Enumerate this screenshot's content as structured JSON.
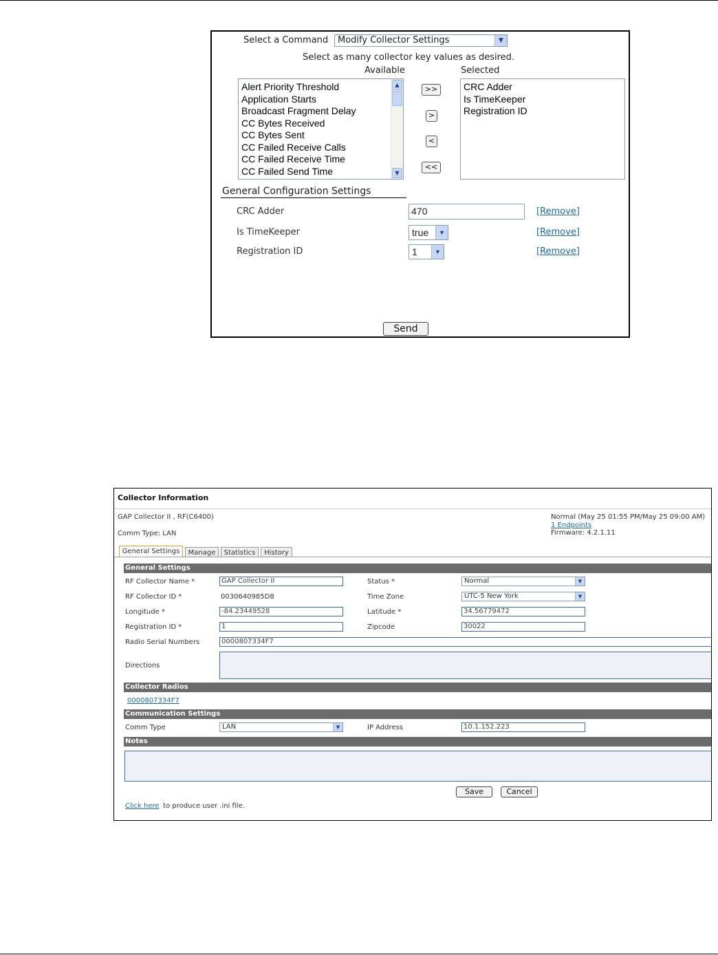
{
  "command_panel": {
    "select_command_label": "Select a Command",
    "command_value": "Modify Collector Settings",
    "instruction": "Select as many collector key values as desired.",
    "available_header": "Available",
    "selected_header": "Selected",
    "available_items": [
      "Alert Priority Threshold",
      "Application Starts",
      "Broadcast Fragment Delay",
      "CC Bytes Received",
      "CC Bytes Sent",
      "CC Failed Receive Calls",
      "CC Failed Receive Time",
      "CC Failed Send Time"
    ],
    "selected_items": [
      "CRC Adder",
      "Is TimeKeeper",
      "Registration ID"
    ],
    "move_buttons": {
      "add_all": ">>",
      "add": ">",
      "remove": "<",
      "remove_all": "<<"
    },
    "section_title": "General Configuration Settings",
    "settings": [
      {
        "label": "CRC Adder",
        "value": "470",
        "remove": "[Remove]"
      },
      {
        "label": "Is TimeKeeper",
        "value": "true",
        "remove": "[Remove]"
      },
      {
        "label": "Registration ID",
        "value": "1",
        "remove": "[Remove]"
      }
    ],
    "send_label": "Send"
  },
  "collector_info": {
    "title": "Collector Information",
    "collector_name_line": "GAP Collector II , RF(C6400)",
    "comm_type_line": "Comm Type: LAN",
    "status_line": "Normal (May 25 01:55 PM/May 25 09:00 AM)",
    "endpoints_link": "1 Endpoints",
    "firmware_line": "Firmware: 4.2.1.11",
    "tabs": [
      "General Settings",
      "Manage",
      "Statistics",
      "History"
    ],
    "active_tab": "General Settings",
    "sections": {
      "general": "General Settings",
      "radios": "Collector Radios",
      "comm": "Communication Settings",
      "notes": "Notes"
    },
    "fields": {
      "rf_name_label": "RF Collector Name *",
      "rf_name_value": "GAP Collector II",
      "rf_id_label": "RF Collector ID *",
      "rf_id_value": "0030640985D8",
      "longitude_label": "Longitude *",
      "longitude_value": "-84.23449528",
      "registration_label": "Registration ID *",
      "registration_value": "1",
      "radio_serial_label": "Radio Serial Numbers",
      "radio_serial_value": "0000807334F7",
      "directions_label": "Directions",
      "status_label": "Status *",
      "status_value": "Normal",
      "timezone_label": "Time Zone",
      "timezone_value": "UTC-5 New York",
      "latitude_label": "Latitude *",
      "latitude_value": "34.56779472",
      "zipcode_label": "Zipcode",
      "zipcode_value": "30022"
    },
    "radio_link": "0000807334F7",
    "comm": {
      "comm_type_label": "Comm Type",
      "comm_type_value": "LAN",
      "ip_label": "IP Address",
      "ip_value": "10.1.152.223"
    },
    "save_label": "Save",
    "cancel_label": "Cancel",
    "click_here_link": "Click here",
    "footer_text": " to produce user .ini file."
  }
}
